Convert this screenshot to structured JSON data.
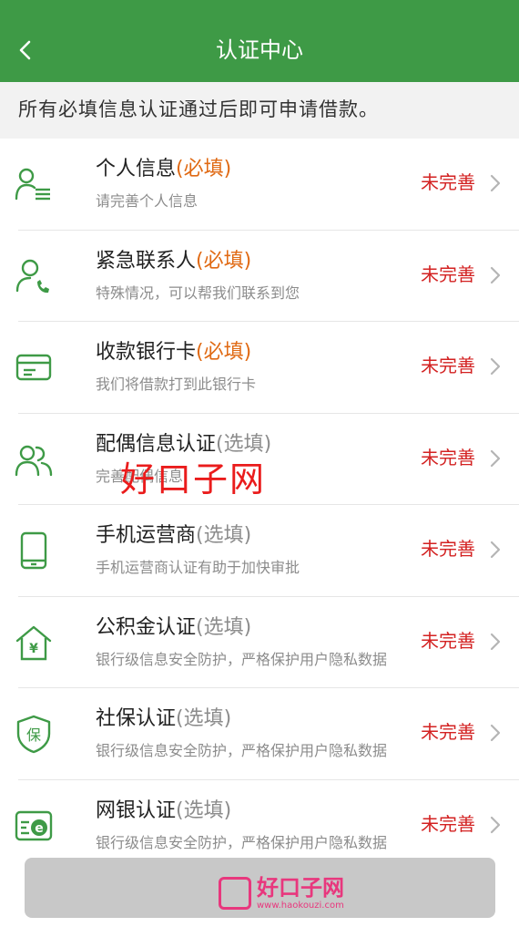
{
  "header": {
    "title": "认证中心",
    "back_icon": "chevron-left-icon"
  },
  "notice": "所有必填信息认证通过后即可申请借款。",
  "colors": {
    "brand": "#3e9a46",
    "status": "#d32222",
    "required": "#e06a14",
    "optional": "#8c8c8c"
  },
  "items": [
    {
      "id": "personal",
      "title": "个人信息",
      "tag": "(必填)",
      "required": true,
      "subtitle": "请完善个人信息",
      "status": "未完善",
      "icon": "person-lines-icon"
    },
    {
      "id": "emergency",
      "title": "紧急联系人",
      "tag": "(必填)",
      "required": true,
      "subtitle": "特殊情况，可以帮我们联系到您",
      "status": "未完善",
      "icon": "person-phone-icon"
    },
    {
      "id": "bankcard",
      "title": "收款银行卡",
      "tag": "(必填)",
      "required": true,
      "subtitle": "我们将借款打到此银行卡",
      "status": "未完善",
      "icon": "bank-card-icon"
    },
    {
      "id": "spouse",
      "title": "配偶信息认证",
      "tag": "(选填)",
      "required": false,
      "subtitle": "完善配偶信息",
      "status": "未完善",
      "icon": "people-icon"
    },
    {
      "id": "carrier",
      "title": "手机运营商",
      "tag": "(选填)",
      "required": false,
      "subtitle": "手机运营商认证有助于加快审批",
      "status": "未完善",
      "icon": "mobile-phone-icon"
    },
    {
      "id": "fund",
      "title": "公积金认证",
      "tag": "(选填)",
      "required": false,
      "subtitle": "银行级信息安全防护，严格保护用户隐私数据",
      "status": "未完善",
      "icon": "house-yen-icon"
    },
    {
      "id": "social",
      "title": "社保认证",
      "tag": "(选填)",
      "required": false,
      "subtitle": "银行级信息安全防护，严格保护用户隐私数据",
      "status": "未完善",
      "icon": "shield-bao-icon"
    },
    {
      "id": "ebank",
      "title": "网银认证",
      "tag": "(选填)",
      "required": false,
      "subtitle": "银行级信息安全防护，严格保护用户隐私数据",
      "status": "未完善",
      "icon": "ebank-card-icon"
    }
  ],
  "watermark": "好口子网",
  "logo": {
    "text": "好口子网",
    "url": "www.haokouzi.com"
  }
}
